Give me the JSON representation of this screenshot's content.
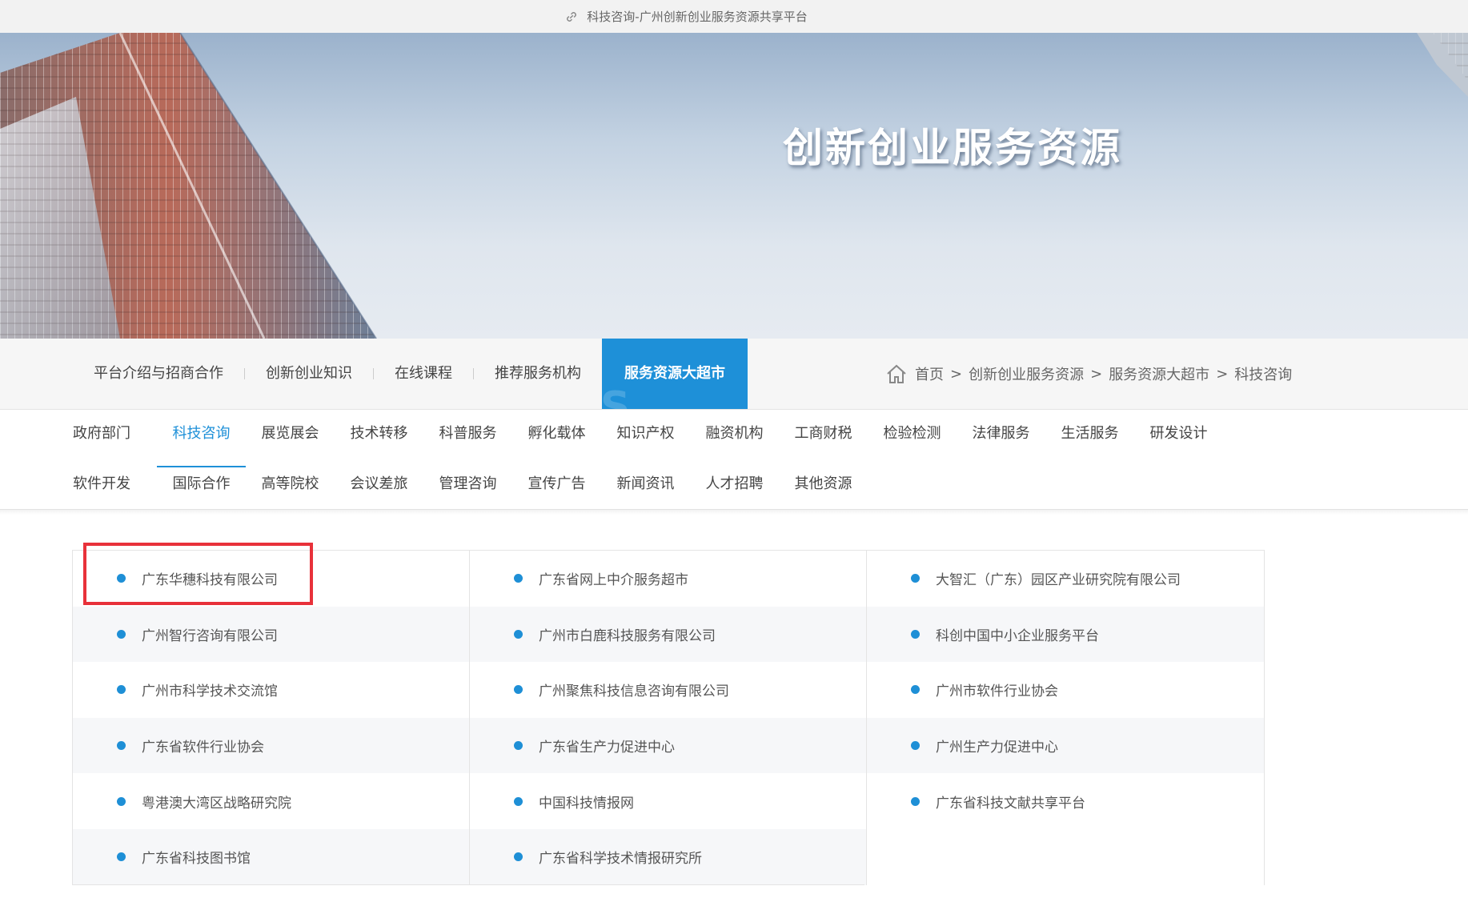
{
  "topbar": {
    "title": "科技咨询-广州创新创业服务资源共享平台",
    "icon": "link-icon"
  },
  "banner": {
    "title": "创新创业服务资源"
  },
  "mainnav": {
    "items": [
      {
        "label": "平台介绍与招商合作"
      },
      {
        "label": "创新创业知识"
      },
      {
        "label": "在线课程"
      },
      {
        "label": "推荐服务机构"
      },
      {
        "label": "服务资源大超市",
        "active": true
      }
    ],
    "active_color": "#1e90d8"
  },
  "breadcrumb": {
    "icon": "home-icon",
    "items": [
      "首页",
      "创新创业服务资源",
      "服务资源大超市",
      "科技咨询"
    ],
    "separator": ">"
  },
  "subcategories": {
    "row1": [
      "政府部门",
      "科技咨询",
      "展览展会",
      "技术转移",
      "科普服务",
      "孵化载体",
      "知识产权",
      "融资机构",
      "工商财税",
      "检验检测",
      "法律服务",
      "生活服务",
      "研发设计"
    ],
    "row2": [
      "软件开发",
      "国际合作",
      "高等院校",
      "会议差旅",
      "管理咨询",
      "宣传广告",
      "新闻资讯",
      "人才招聘",
      "其他资源"
    ],
    "active": "科技咨询"
  },
  "resources": {
    "rows": [
      [
        "广东华穗科技有限公司",
        "广东省网上中介服务超市",
        "大智汇（广东）园区产业研究院有限公司"
      ],
      [
        "广州智行咨询有限公司",
        "广州市白鹿科技服务有限公司",
        "科创中国中小企业服务平台"
      ],
      [
        "广州市科学技术交流馆",
        "广州聚焦科技信息咨询有限公司",
        "广州市软件行业协会"
      ],
      [
        "广东省软件行业协会",
        "广东省生产力促进中心",
        "广州生产力促进中心"
      ],
      [
        "粤港澳大湾区战略研究院",
        "中国科技情报网",
        "广东省科技文献共享平台"
      ],
      [
        "广东省科技图书馆",
        "广东省科学技术情报研究所",
        ""
      ]
    ],
    "bullet_color": "#1e8fd6",
    "highlight_color": "#e8313a"
  }
}
